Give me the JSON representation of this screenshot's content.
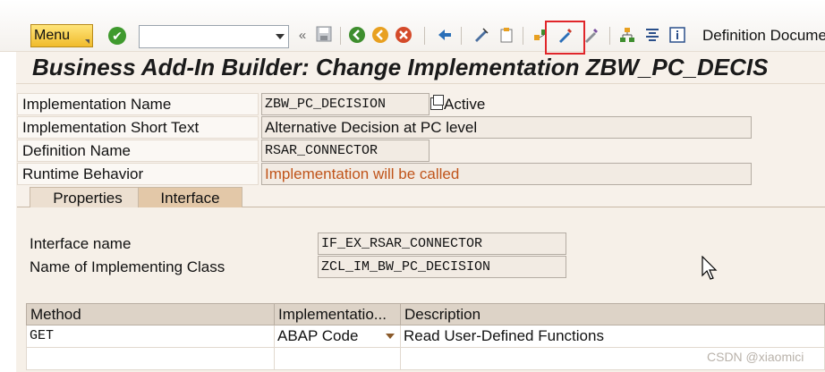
{
  "toolbar": {
    "menu_label": "Menu",
    "command_field_value": "",
    "definition_doc_label": "Definition Docume",
    "icons": [
      "enter-check-icon",
      "back-nav-icon",
      "save-icon",
      "back-icon",
      "exit-icon",
      "cancel-icon",
      "other-object-icon",
      "display-change-icon",
      "activate-icon",
      "test-icon",
      "highlighted-edit-icon",
      "wand-icon",
      "hierarchy-icon",
      "align-icon",
      "info-icon"
    ]
  },
  "page": {
    "title": "Business Add-In Builder: Change Implementation ZBW_PC_DECIS"
  },
  "form": {
    "implementation_name_label": "Implementation Name",
    "implementation_name_value": "ZBW_PC_DECISION",
    "active_label": "Active",
    "short_text_label": "Implementation Short Text",
    "short_text_value": "Alternative Decision at PC level",
    "definition_name_label": "Definition Name",
    "definition_name_value": "RSAR_CONNECTOR",
    "runtime_label": "Runtime Behavior",
    "runtime_value": "Implementation will be called"
  },
  "tabs": [
    {
      "label": "Properties",
      "active": false
    },
    {
      "label": "Interface",
      "active": true
    }
  ],
  "interface": {
    "interface_name_label": "Interface name",
    "interface_name_value": "IF_EX_RSAR_CONNECTOR",
    "class_label": "Name of Implementing Class",
    "class_value": "ZCL_IM_BW_PC_DECISION"
  },
  "methods_table": {
    "columns": [
      "Method",
      "Implementatio...",
      "Description"
    ],
    "rows": [
      {
        "method": "GET",
        "implementation": "ABAP Code",
        "description": "Read User-Defined Functions"
      },
      {
        "method": "",
        "implementation": "",
        "description": ""
      }
    ]
  },
  "watermark": "CSDN @xiaomici",
  "colors": {
    "menu_button": "#f0bb2c",
    "highlight_box": "#e0262a",
    "runtime_text": "#c0541a"
  }
}
